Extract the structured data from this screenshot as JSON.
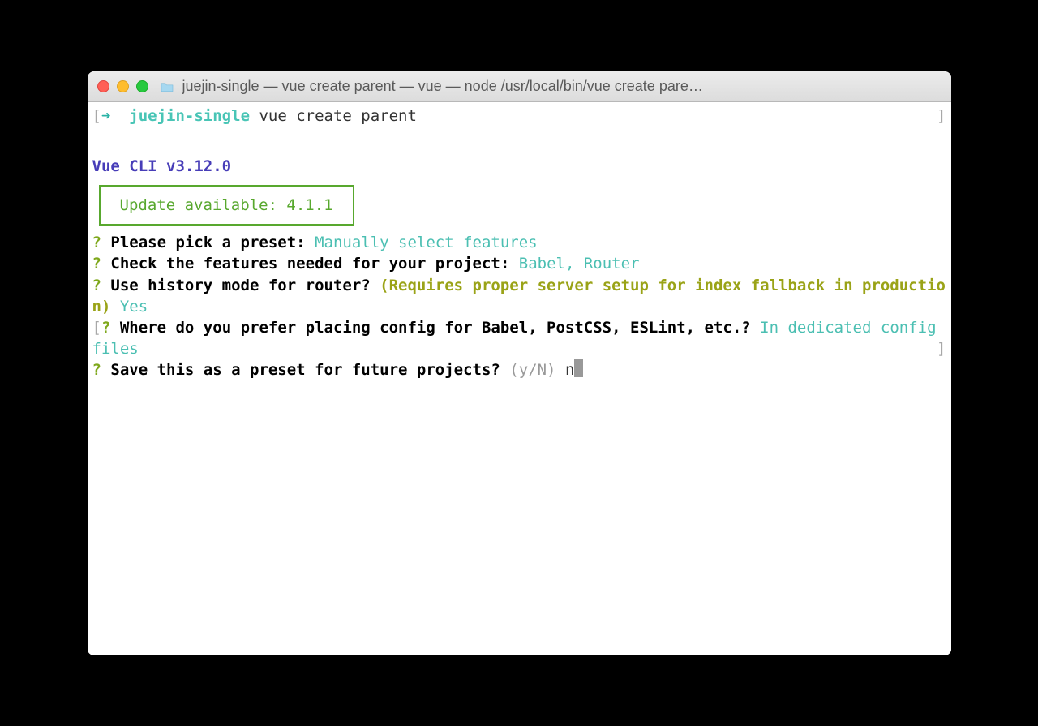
{
  "window": {
    "title": "juejin-single — vue create parent — vue — node /usr/local/bin/vue create pare…"
  },
  "prompt": {
    "arrow": "➜",
    "dir": "juejin-single",
    "command": "vue create parent"
  },
  "cli": {
    "header": "Vue CLI v3.12.0",
    "update_box": "Update available: 4.1.1"
  },
  "questions": {
    "q1": {
      "mark": "?",
      "text": "Please pick a preset:",
      "answer": "Manually select features"
    },
    "q2": {
      "mark": "?",
      "text": "Check the features needed for your project:",
      "answer": "Babel, Router"
    },
    "q3": {
      "mark": "?",
      "text": "Use history mode for router?",
      "hint": "(Requires proper server setup for index fallback in production)",
      "answer": "Yes"
    },
    "q4": {
      "mark": "?",
      "text": "Where do you prefer placing config for Babel, PostCSS, ESLint, etc.?",
      "answer": "In dedicated config files"
    },
    "q5": {
      "mark": "?",
      "text": "Save this as a preset for future projects?",
      "hint": "(y/N)",
      "input": "n"
    }
  }
}
